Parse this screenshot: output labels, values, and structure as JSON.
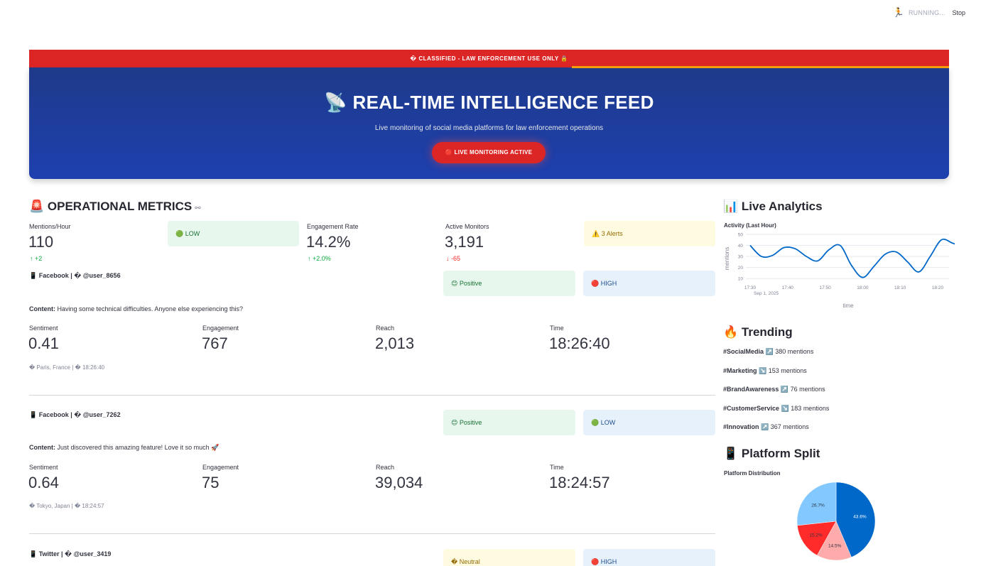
{
  "status": {
    "running": "RUNNING...",
    "stop": "Stop"
  },
  "banner": {
    "classified": "� CLASSIFIED - LAW ENFORCEMENT USE ONLY 🔒"
  },
  "hero": {
    "title": "📡 REAL-TIME INTELLIGENCE FEED",
    "subtitle": "Live monitoring of social media platforms for law enforcement operations",
    "pill": "🔴 LIVE MONITORING ACTIVE"
  },
  "ops": {
    "title": "🚨 OPERATIONAL METRICS",
    "link_icon": "⚯",
    "metrics": [
      {
        "label": "Mentions/Hour",
        "value": "110",
        "delta": "↑ +2",
        "direction": "up"
      },
      {
        "label": "Engagement Rate",
        "value": "14.2%",
        "delta": "↑ +2.0%",
        "direction": "up"
      },
      {
        "label": "Active Monitors",
        "value": "3,191",
        "delta": "↓ -65",
        "direction": "down"
      }
    ],
    "threat_badge": "🟢 LOW",
    "alerts_badge": "⚠️ 3 Alerts"
  },
  "posts": [
    {
      "header": "📱 Facebook | � @user_8656",
      "sentiment_badge": "😊 Positive",
      "priority_badge": "🔴 HIGH",
      "content_label": "Content:",
      "content": "Having some technical difficulties. Anyone else experiencing this?",
      "stats": [
        {
          "label": "Sentiment",
          "value": "0.41"
        },
        {
          "label": "Engagement",
          "value": "767"
        },
        {
          "label": "Reach",
          "value": "2,013"
        },
        {
          "label": "Time",
          "value": "18:26:40"
        }
      ],
      "meta": "� Paris, France | � 18:26:40"
    },
    {
      "header": "📱 Facebook | � @user_7262",
      "sentiment_badge": "😊 Positive",
      "priority_badge": "🟢 LOW",
      "content_label": "Content:",
      "content": "Just discovered this amazing feature! Love it so much 🚀",
      "stats": [
        {
          "label": "Sentiment",
          "value": "0.64"
        },
        {
          "label": "Engagement",
          "value": "75"
        },
        {
          "label": "Reach",
          "value": "39,034"
        },
        {
          "label": "Time",
          "value": "18:24:57"
        }
      ],
      "meta": "� Tokyo, Japan | � 18:24:57"
    },
    {
      "header": "📱 Twitter | � @user_3419",
      "sentiment_badge": "� Neutral",
      "priority_badge": "🔴 HIGH"
    }
  ],
  "analytics": {
    "title": "📊 Live Analytics",
    "chart_title": "Activity (Last Hour)",
    "ylabel": "mentions",
    "xlabel": "time",
    "date_label": "Sep 1, 2025"
  },
  "trending": {
    "title": "🔥 Trending",
    "items": [
      {
        "tag": "#SocialMedia",
        "trend": "↗️",
        "count": "380 mentions"
      },
      {
        "tag": "#Marketing",
        "trend": "↘️",
        "count": "153 mentions"
      },
      {
        "tag": "#BrandAwareness",
        "trend": "↗️",
        "count": "76 mentions"
      },
      {
        "tag": "#CustomerService",
        "trend": "↘️",
        "count": "183 mentions"
      },
      {
        "tag": "#Innovation",
        "trend": "↗️",
        "count": "367 mentions"
      }
    ]
  },
  "platform": {
    "title": "📱 Platform Split",
    "chart_title": "Platform Distribution"
  },
  "chart_data": [
    {
      "type": "line",
      "title": "Activity (Last Hour)",
      "xlabel": "time",
      "ylabel": "mentions",
      "x_ticks": [
        "17:30",
        "17:40",
        "17:50",
        "18:00",
        "18:10",
        "18:20"
      ],
      "y_ticks": [
        10,
        20,
        30,
        40,
        50
      ],
      "ylim": [
        5,
        50
      ],
      "x": [
        "17:30",
        "17:33",
        "17:36",
        "17:39",
        "17:42",
        "17:45",
        "17:48",
        "17:51",
        "17:54",
        "17:57",
        "18:00",
        "18:03",
        "18:06",
        "18:09",
        "18:12",
        "18:15",
        "18:18",
        "18:21",
        "18:24",
        "18:27"
      ],
      "y": [
        40,
        30,
        31,
        38,
        37,
        30,
        26,
        36,
        40,
        22,
        11,
        21,
        32,
        34,
        25,
        16,
        30,
        45,
        42,
        38
      ],
      "color": "#0068c9",
      "grid": true
    },
    {
      "type": "pie",
      "title": "Platform Distribution",
      "slices": [
        {
          "value": 43.6,
          "label": "43.6%",
          "color": "#0068c9"
        },
        {
          "value": 14.5,
          "label": "14.5%",
          "color": "#ffabab"
        },
        {
          "value": 15.2,
          "label": "15.2%",
          "color": "#ff2b2b"
        },
        {
          "value": 26.7,
          "label": "26.7%",
          "color": "#83c9ff"
        }
      ]
    }
  ]
}
